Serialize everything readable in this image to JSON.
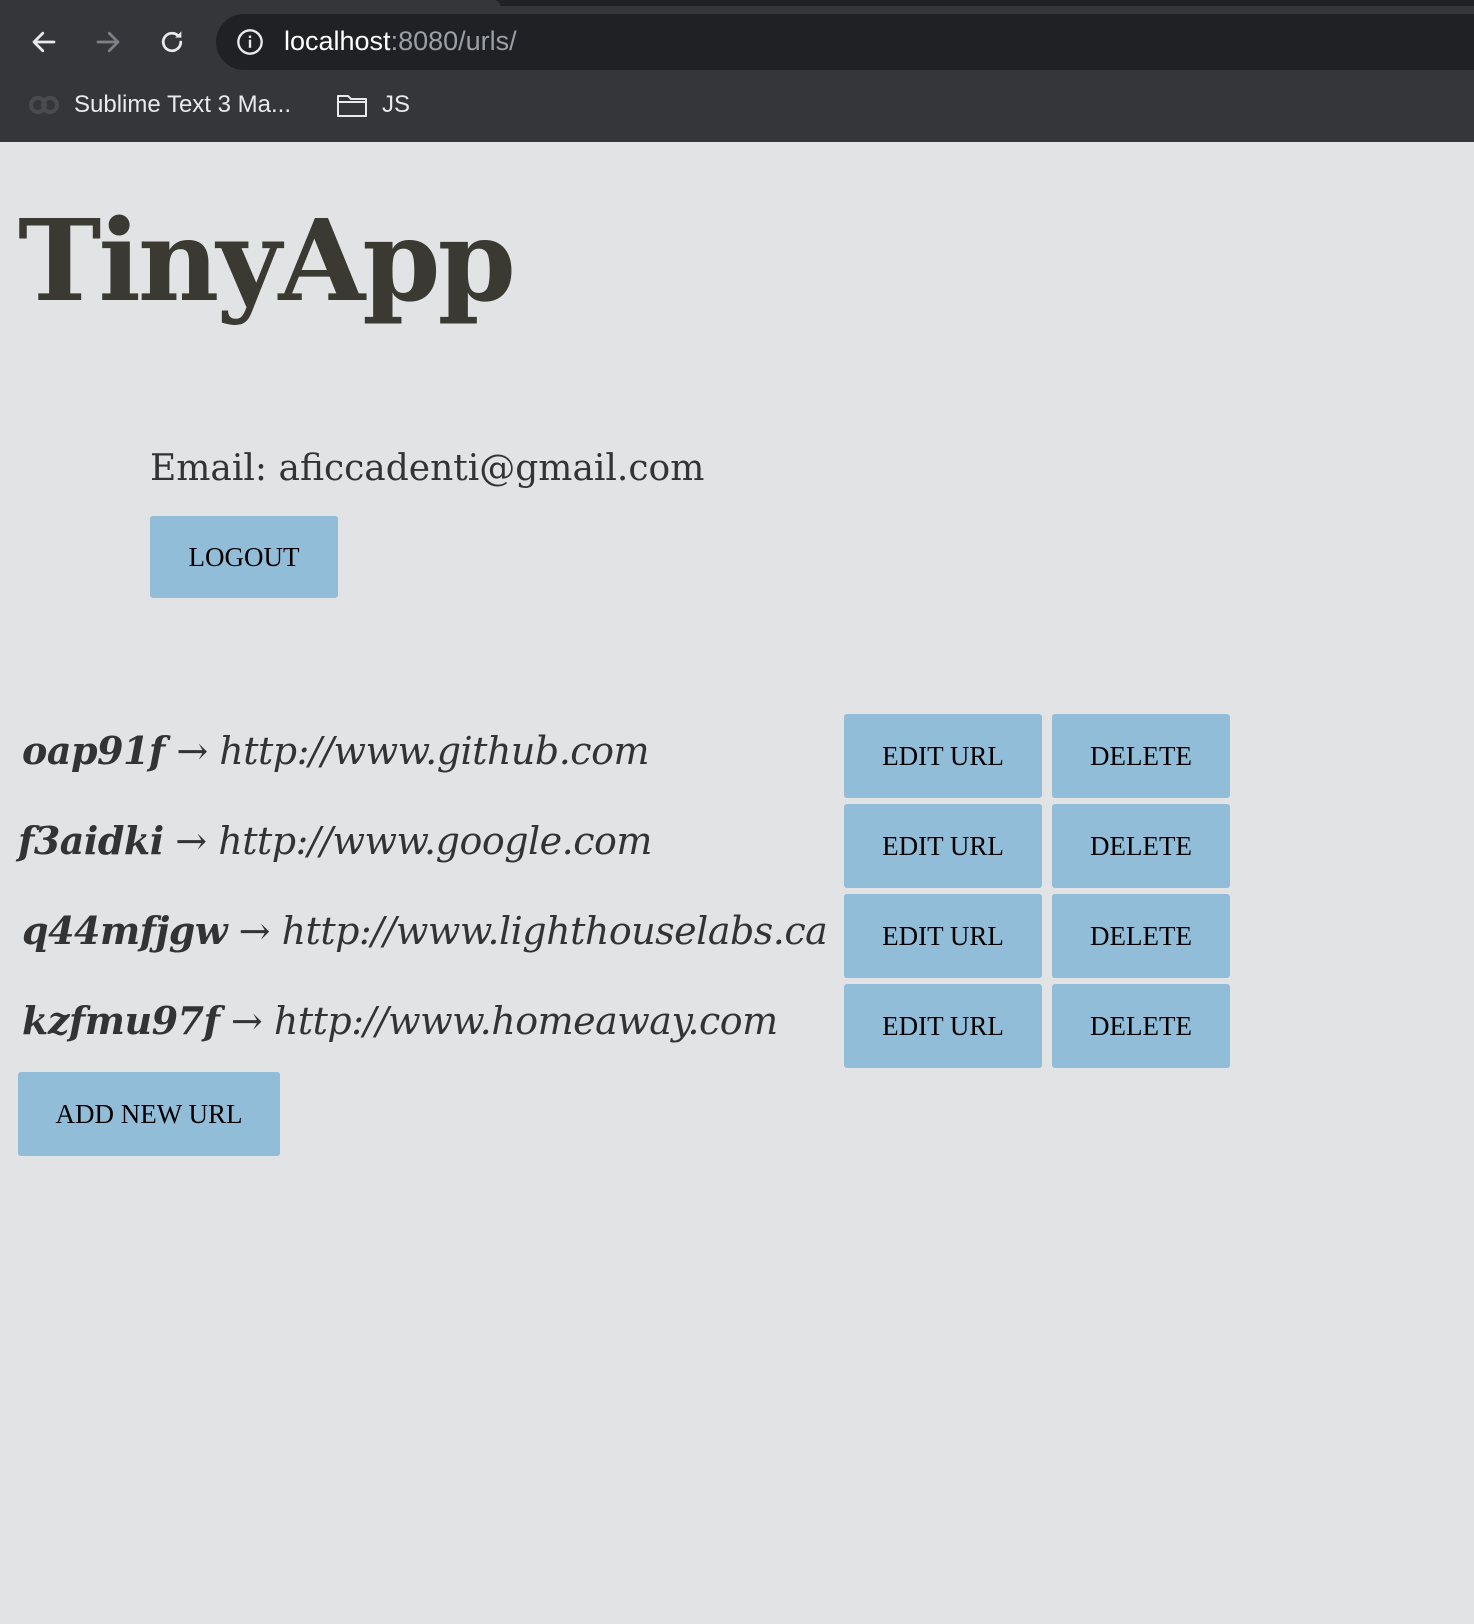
{
  "browser": {
    "url_host": "localhost",
    "url_rest": ":8080/urls/",
    "bookmarks": [
      {
        "label": "Sublime Text 3 Ma...",
        "icon": "sublime-icon"
      },
      {
        "label": "JS",
        "icon": "folder-icon"
      }
    ]
  },
  "app": {
    "title": "TinyApp"
  },
  "user": {
    "email_line": "Email: aficcadenti@gmail.com",
    "logout_label": "LOGOUT"
  },
  "urls": [
    {
      "short": "oap91f",
      "arrow": "→",
      "long": "http://www.github.com"
    },
    {
      "short": "f3aidki",
      "arrow": "→",
      "long": "http://www.google.com"
    },
    {
      "short": "q44mfjgw",
      "arrow": "→",
      "long": "http://www.lighthouselabs.ca"
    },
    {
      "short": "kzfmu97f",
      "arrow": "→",
      "long": "http://www.homeaway.com"
    }
  ],
  "actions": {
    "edit_label": "EDIT URL",
    "delete_label": "DELETE",
    "add_label": "ADD NEW URL"
  },
  "colors": {
    "button_bg": "#92bdd8",
    "page_bg": "#e2e3e5",
    "chrome_bg": "#35363a"
  }
}
